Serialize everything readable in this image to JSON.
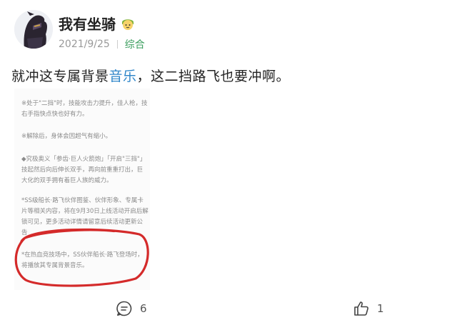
{
  "post": {
    "author": "我有坐骑",
    "date": "2021/9/25",
    "category": "综合",
    "text_before": "就冲这专属背景",
    "text_link": "音乐",
    "text_after": "，这二挡路飞也要冲啊。"
  },
  "attachment": {
    "paragraphs": [
      "※处于\"二挡\"时，技能攻击力提升，佳人枪，技右手指快点快也好有力。",
      "※解除后，身体会因超气有缩小。",
      "◆究极奥义「参齿·巨人火箭炮」「开启\"三挡\"」技起然后向后伸长双手，再向前重重打出，巨大化的双手拥有着巨人族的威力。",
      "*SS级船长·路飞伙伴图鉴、伙伴形象、专属卡片等相关内容，将在9月30日上线活动开启后解锁可见，更多活动详情请留意后续活动更新公告",
      "*在热血竞技场中，SS伙伴船长·路飞登场时，将播放其专属背景音乐。"
    ]
  },
  "actions": {
    "comments_count": "6",
    "likes_count": "1"
  },
  "colors": {
    "category": "#3a9d5d",
    "link": "#2f86c9",
    "highlight_circle": "#d42a2a"
  },
  "icons": [
    "avatar-ninja-icon",
    "badge-face-icon",
    "comment-icon",
    "thumbs-up-icon"
  ]
}
